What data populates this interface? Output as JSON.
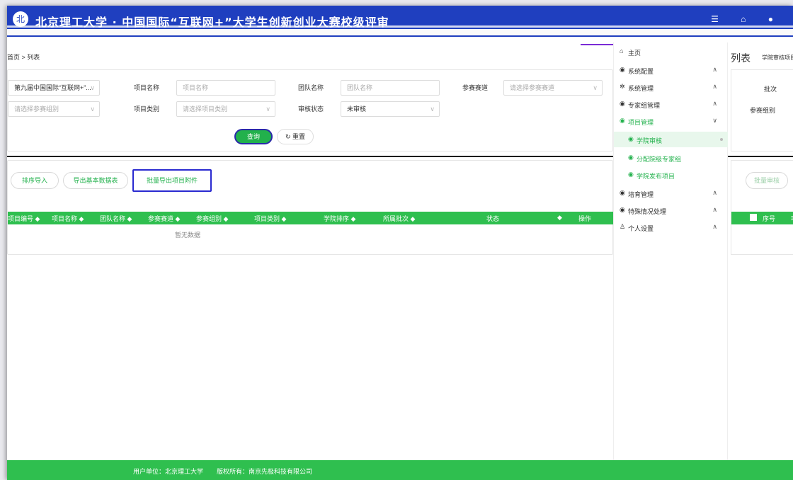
{
  "header": {
    "logo_text": "北",
    "title": "北京理工大学 · 中国国际“互联网+”大学生创新创业大赛校级评审",
    "right_icons": "☰ ⌂ ●"
  },
  "breadcrumb": "首页 > 列表",
  "search": {
    "session_value": "第九届中国国际“互联网+”...",
    "group_placeholder": "请选择参赛组别",
    "project_name_label": "项目名称",
    "project_name_placeholder": "项目名称",
    "project_type_label": "项目类别",
    "project_type_placeholder": "请选择项目类别",
    "team_name_label": "团队名称",
    "team_name_placeholder": "团队名称",
    "review_status_label": "审核状态",
    "review_status_value": "未审核",
    "track_label": "参赛赛道",
    "track_placeholder": "请选择参赛赛道",
    "query_button": "查询",
    "reset_button": "重置"
  },
  "actions": {
    "sort_import": "排序导入",
    "export_basic": "导出基本数据表",
    "batch_export": "批量导出项目附件"
  },
  "table": {
    "headers": [
      "项目编号",
      "项目名称",
      "团队名称",
      "参赛赛道",
      "参赛组别",
      "项目类别",
      "学院排序",
      "所属批次",
      "状态",
      "操作"
    ],
    "empty_text": "暂无数据"
  },
  "nav": {
    "items": [
      {
        "icon": "home-icon",
        "label": "主页"
      },
      {
        "icon": "cube-icon",
        "label": "系统配置"
      },
      {
        "icon": "gear-icon",
        "label": "系统管理"
      },
      {
        "icon": "cube-icon",
        "label": "专家组管理"
      },
      {
        "icon": "cube-icon",
        "label": "项目管理"
      },
      {
        "icon": "cube-icon",
        "label": "学院审核"
      },
      {
        "icon": "cube-icon",
        "label": "分配院级专家组"
      },
      {
        "icon": "cube-icon",
        "label": "学院发布项目"
      },
      {
        "icon": "cube-icon",
        "label": "培育管理"
      },
      {
        "icon": "cube-icon",
        "label": "特殊情况处理"
      },
      {
        "icon": "user-icon",
        "label": "个人设置"
      }
    ]
  },
  "right_panel": {
    "title": "列表",
    "subtitle": "学院审核项目",
    "batch_label": "批次",
    "group_label": "参赛组别",
    "batch_review": "批量审核",
    "seq_header": "序号",
    "project_header": "项"
  },
  "footer": {
    "unit": "用户单位：北京理工大学",
    "copyright": "版权所有：南京先极科技有限公司"
  },
  "colors": {
    "primary_green": "#2fbf4f",
    "header_blue": "#1f3fbf",
    "highlight_border": "#2a2ad0"
  }
}
